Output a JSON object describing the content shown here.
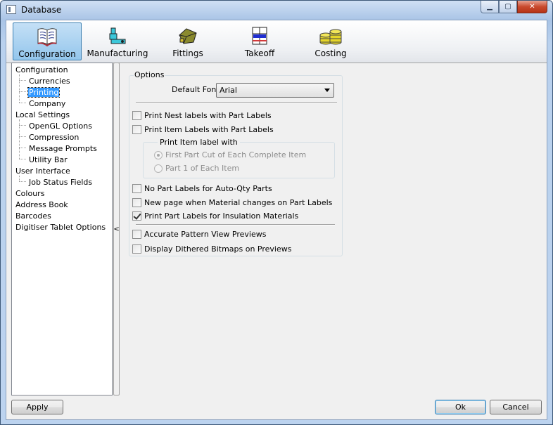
{
  "window": {
    "title": "Database"
  },
  "caption": {
    "minimize": "▁",
    "maximize": "▢",
    "close": "✕"
  },
  "toolbar": {
    "items": [
      {
        "label": "Configuration",
        "icon": "book-icon",
        "active": true
      },
      {
        "label": "Manufacturing",
        "icon": "machine-icon",
        "active": false
      },
      {
        "label": "Fittings",
        "icon": "fitting-icon",
        "active": false
      },
      {
        "label": "Takeoff",
        "icon": "takeoff-icon",
        "active": false
      },
      {
        "label": "Costing",
        "icon": "coins-icon",
        "active": false
      }
    ]
  },
  "tree": {
    "items": [
      {
        "label": "Configuration",
        "level": 0
      },
      {
        "label": "Currencies",
        "level": 1
      },
      {
        "label": "Printing",
        "level": 1,
        "selected": true
      },
      {
        "label": "Company",
        "level": 1
      },
      {
        "label": "Local Settings",
        "level": 0
      },
      {
        "label": "OpenGL Options",
        "level": 1
      },
      {
        "label": "Compression",
        "level": 1
      },
      {
        "label": "Message Prompts",
        "level": 1
      },
      {
        "label": "Utility Bar",
        "level": 1
      },
      {
        "label": "User Interface",
        "level": 0
      },
      {
        "label": "Job Status Fields",
        "level": 1
      },
      {
        "label": "Colours",
        "level": 0
      },
      {
        "label": "Address Book",
        "level": 0
      },
      {
        "label": "Barcodes",
        "level": 0
      },
      {
        "label": "Digitiser Tablet Options",
        "level": 0
      }
    ]
  },
  "splitter": {
    "glyph": "<"
  },
  "options": {
    "group_label": "Options",
    "default_font_label": "Default Font",
    "default_font_value": "Arial",
    "checks": [
      {
        "label": "Print Nest labels with Part Labels",
        "checked": false
      },
      {
        "label": "Print Item Labels with Part Labels",
        "checked": false
      },
      {
        "label": "No Part Labels for Auto-Qty Parts",
        "checked": false
      },
      {
        "label": "New page when Material changes on Part Labels",
        "checked": false
      },
      {
        "label": "Print Part Labels for Insulation Materials",
        "checked": true
      },
      {
        "label": "Accurate Pattern View Previews",
        "checked": false
      },
      {
        "label": "Display Dithered Bitmaps on Previews",
        "checked": false
      }
    ],
    "item_label_group": {
      "label": "Print Item label with",
      "radios": [
        {
          "label": "First Part Cut of Each Complete Item",
          "checked": true
        },
        {
          "label": "Part 1 of Each Item",
          "checked": false
        }
      ]
    }
  },
  "buttons": {
    "apply": "Apply",
    "ok": "Ok",
    "cancel": "Cancel"
  }
}
